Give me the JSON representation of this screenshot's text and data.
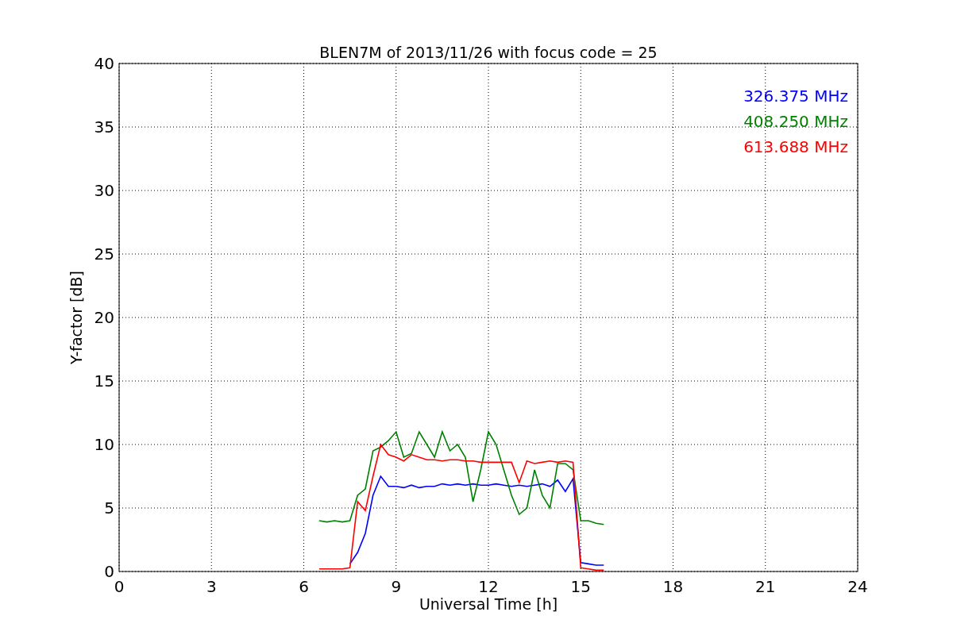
{
  "chart_data": {
    "type": "line",
    "title": "BLEN7M of 2013/11/26 with focus code = 25",
    "xlabel": "Universal Time [h]",
    "ylabel": "Y-factor [dB]",
    "x": [
      6.5,
      6.75,
      7.0,
      7.25,
      7.5,
      7.75,
      8.0,
      8.25,
      8.5,
      8.75,
      9.0,
      9.25,
      9.5,
      9.75,
      10.0,
      10.25,
      10.5,
      10.75,
      11.0,
      11.25,
      11.5,
      11.75,
      12.0,
      12.25,
      12.5,
      12.75,
      13.0,
      13.25,
      13.5,
      13.75,
      14.0,
      14.25,
      14.5,
      14.75,
      15.0,
      15.25,
      15.5,
      15.75
    ],
    "series": [
      {
        "name": "326.375 MHz",
        "color": "#0000ff",
        "values": [
          null,
          null,
          null,
          null,
          0.6,
          1.5,
          3.0,
          6.0,
          7.5,
          6.7,
          6.7,
          6.6,
          6.8,
          6.6,
          6.7,
          6.7,
          6.9,
          6.8,
          6.9,
          6.8,
          6.9,
          6.8,
          6.8,
          6.9,
          6.8,
          6.7,
          6.8,
          6.7,
          6.8,
          6.9,
          6.7,
          7.2,
          6.3,
          7.3,
          0.7,
          0.6,
          0.5,
          0.5
        ]
      },
      {
        "name": "408.250 MHz",
        "color": "#008000",
        "values": [
          4.0,
          3.9,
          4.0,
          3.9,
          4.0,
          6.0,
          6.5,
          9.5,
          9.8,
          10.3,
          11.0,
          9.0,
          9.3,
          11.0,
          10.0,
          9.0,
          11.0,
          9.5,
          10.0,
          9.0,
          5.5,
          8.0,
          11.0,
          10.0,
          8.0,
          6.0,
          4.5,
          5.0,
          8.0,
          6.0,
          5.0,
          8.5,
          8.5,
          8.0,
          4.0,
          4.0,
          3.8,
          3.7
        ]
      },
      {
        "name": "613.688 MHz",
        "color": "#ff0000",
        "values": [
          0.2,
          0.2,
          0.2,
          0.2,
          0.3,
          5.5,
          4.8,
          7.5,
          10.0,
          9.2,
          9.0,
          8.7,
          9.2,
          9.0,
          8.8,
          8.8,
          8.7,
          8.8,
          8.8,
          8.7,
          8.7,
          8.6,
          8.6,
          8.6,
          8.6,
          8.6,
          7.0,
          8.7,
          8.5,
          8.6,
          8.7,
          8.6,
          8.7,
          8.6,
          0.3,
          0.2,
          0.1,
          0.1
        ]
      }
    ],
    "grid": true,
    "xlim": [
      0,
      24
    ],
    "ylim": [
      0,
      40
    ],
    "xticks": [
      0,
      3,
      6,
      9,
      12,
      15,
      18,
      21,
      24
    ],
    "yticks": [
      0,
      5,
      10,
      15,
      20,
      25,
      30,
      35,
      40
    ]
  }
}
